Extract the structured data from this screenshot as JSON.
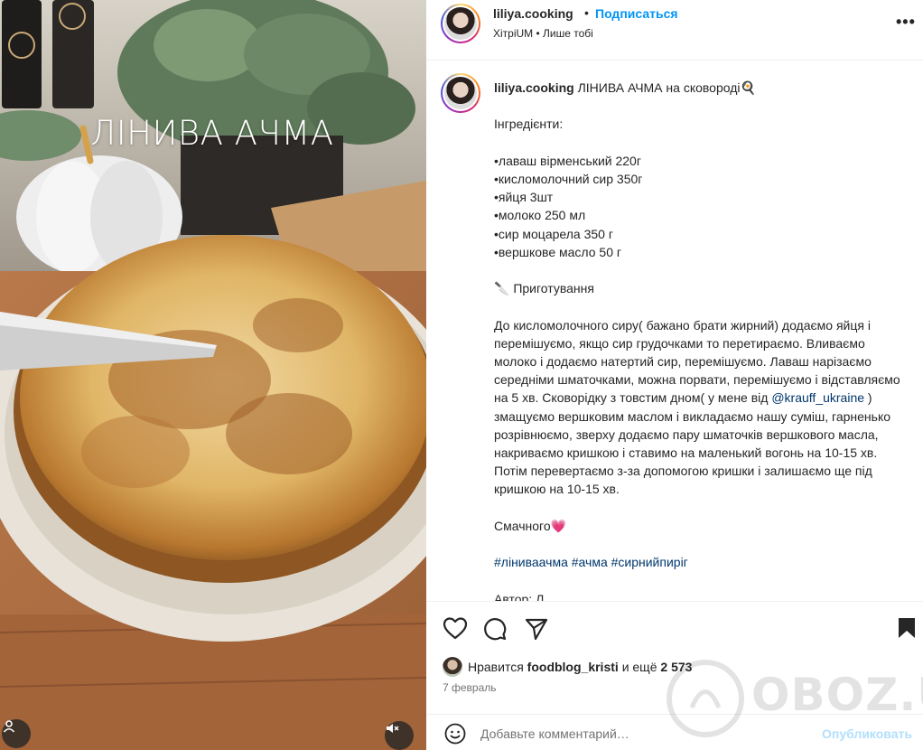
{
  "media": {
    "overlay_title": "ЛІНИВА АЧМА",
    "profile_icon": "user-tag-icon",
    "mute_icon": "speaker-muted-icon"
  },
  "header": {
    "username": "liliya.cooking",
    "separator": "•",
    "follow_label": "Подписаться",
    "subtitle": "ХітріUM • Лише тобі",
    "more_icon": "more-horizontal-icon",
    "more_label": "•••"
  },
  "caption": {
    "username": "liliya.cooking",
    "title_text": "ЛІНИВА АЧМА на сковороді",
    "title_emoji": "🍳",
    "ingredients_heading": "Інгредієнти:",
    "ingredients": [
      "•лаваш вірменський 220г",
      "•кисломолочний сир 350г",
      "•яйця 3шт",
      "•молоко 250 мл",
      "•сир моцарела 350 г",
      "•вершкове масло 50 г"
    ],
    "prep_emoji": "🔪",
    "prep_heading": "Приготування",
    "method_part1": "До кисломолочного сиру( бажано брати жирний) додаємо яйця і перемішуємо, якщо сир грудочками то перетираємо. Вливаємо молоко і додаємо натертий сир, перемішуємо. Лаваш нарізаємо середніми шматочками, можна порвати, перемішуємо і відставляємо на 5 хв. Сковорідку з товстим дном( у мене від ",
    "mention": "@krauff_ukraine",
    "method_part2": " ) змащуємо вершковим маслом і викладаємо нашу суміш, гарненько розрівнюємо, зверху додаємо пару шматочків вершкового масла, накриваємо кришкою і ставимо на маленький вогонь на 10-15 хв. Потім перевертаємо з-за допомогою кришки і залишаємо ще під кришкою на 10-15 хв.",
    "tasty_text": "Смачного",
    "tasty_emoji": "💗",
    "hashtags": "#ліниваачма #ачма #сирнийпиріг",
    "cut_line": "Автор: Л"
  },
  "actions": {
    "like_icon": "heart-icon",
    "comment_icon": "comment-icon",
    "share_icon": "send-icon",
    "save_icon": "bookmark-icon"
  },
  "likes": {
    "prefix": "Нравится",
    "user": "foodblog_kristi",
    "middle": "и ещё",
    "count": "2 573"
  },
  "date": "7 февраль",
  "comment": {
    "emoji_icon": "smiley-icon",
    "placeholder": "Добавьте комментарий…",
    "publish_label": "Опубликовать"
  },
  "watermark": {
    "text": "OBOZ.UA"
  },
  "colors": {
    "link": "#0095f6",
    "mention": "#00376b",
    "text": "#262626",
    "muted": "#737373",
    "publish_disabled": "#b2dffc",
    "heart": "#ff3040"
  }
}
